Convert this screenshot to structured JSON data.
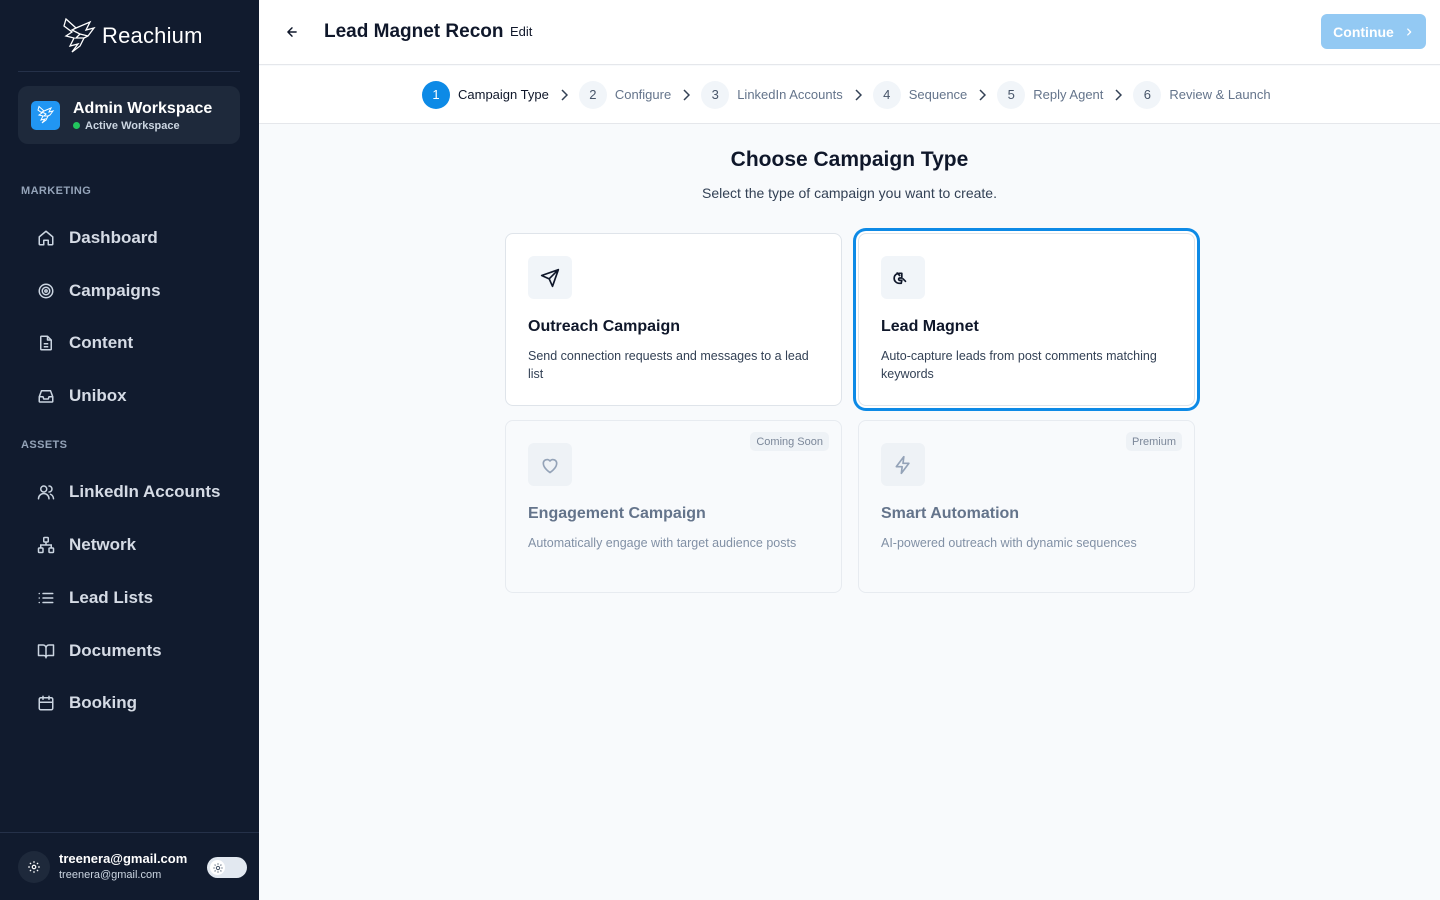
{
  "app": {
    "brand_name": "Reachium"
  },
  "workspace": {
    "name": "Admin Workspace",
    "status": "Active Workspace"
  },
  "sidebar": {
    "sections": [
      {
        "label": "MARKETING",
        "items": [
          {
            "label": "Dashboard",
            "icon": "home-icon"
          },
          {
            "label": "Campaigns",
            "icon": "target-icon"
          },
          {
            "label": "Content",
            "icon": "document-icon"
          },
          {
            "label": "Unibox",
            "icon": "inbox-icon"
          }
        ]
      },
      {
        "label": "ASSETS",
        "items": [
          {
            "label": "LinkedIn Accounts",
            "icon": "users-icon"
          },
          {
            "label": "Network",
            "icon": "network-icon"
          },
          {
            "label": "Lead Lists",
            "icon": "list-icon"
          },
          {
            "label": "Documents",
            "icon": "book-icon"
          },
          {
            "label": "Booking",
            "icon": "calendar-icon"
          }
        ]
      }
    ]
  },
  "user": {
    "name": "treenera@gmail.com",
    "email": "treenera@gmail.com"
  },
  "header": {
    "title": "Lead Magnet Recon",
    "edit_label": "Edit",
    "continue_label": "Continue"
  },
  "steps": [
    {
      "num": "1",
      "label": "Campaign Type",
      "active": true
    },
    {
      "num": "2",
      "label": "Configure",
      "active": false
    },
    {
      "num": "3",
      "label": "LinkedIn Accounts",
      "active": false
    },
    {
      "num": "4",
      "label": "Sequence",
      "active": false
    },
    {
      "num": "5",
      "label": "Reply Agent",
      "active": false
    },
    {
      "num": "6",
      "label": "Review & Launch",
      "active": false
    }
  ],
  "main": {
    "title": "Choose Campaign Type",
    "subtitle": "Select the type of campaign you want to create.",
    "cards": [
      {
        "title": "Outreach Campaign",
        "desc": "Send connection requests and messages to a lead list",
        "icon": "send-icon",
        "selected": false,
        "badge": ""
      },
      {
        "title": "Lead Magnet",
        "desc": "Auto-capture leads from post comments matching keywords",
        "icon": "magnet-icon",
        "selected": true,
        "badge": ""
      },
      {
        "title": "Engagement Campaign",
        "desc": "Automatically engage with target audience posts",
        "icon": "heart-icon",
        "selected": false,
        "badge": "Coming Soon"
      },
      {
        "title": "Smart Automation",
        "desc": "AI-powered outreach with dynamic sequences",
        "icon": "lightning-icon",
        "selected": false,
        "badge": "Premium"
      }
    ]
  },
  "colors": {
    "sidebar_bg": "#111b2e",
    "accent": "#0d8ae6",
    "continue_disabled": "#93c9f3",
    "status_green": "#22c55e"
  }
}
